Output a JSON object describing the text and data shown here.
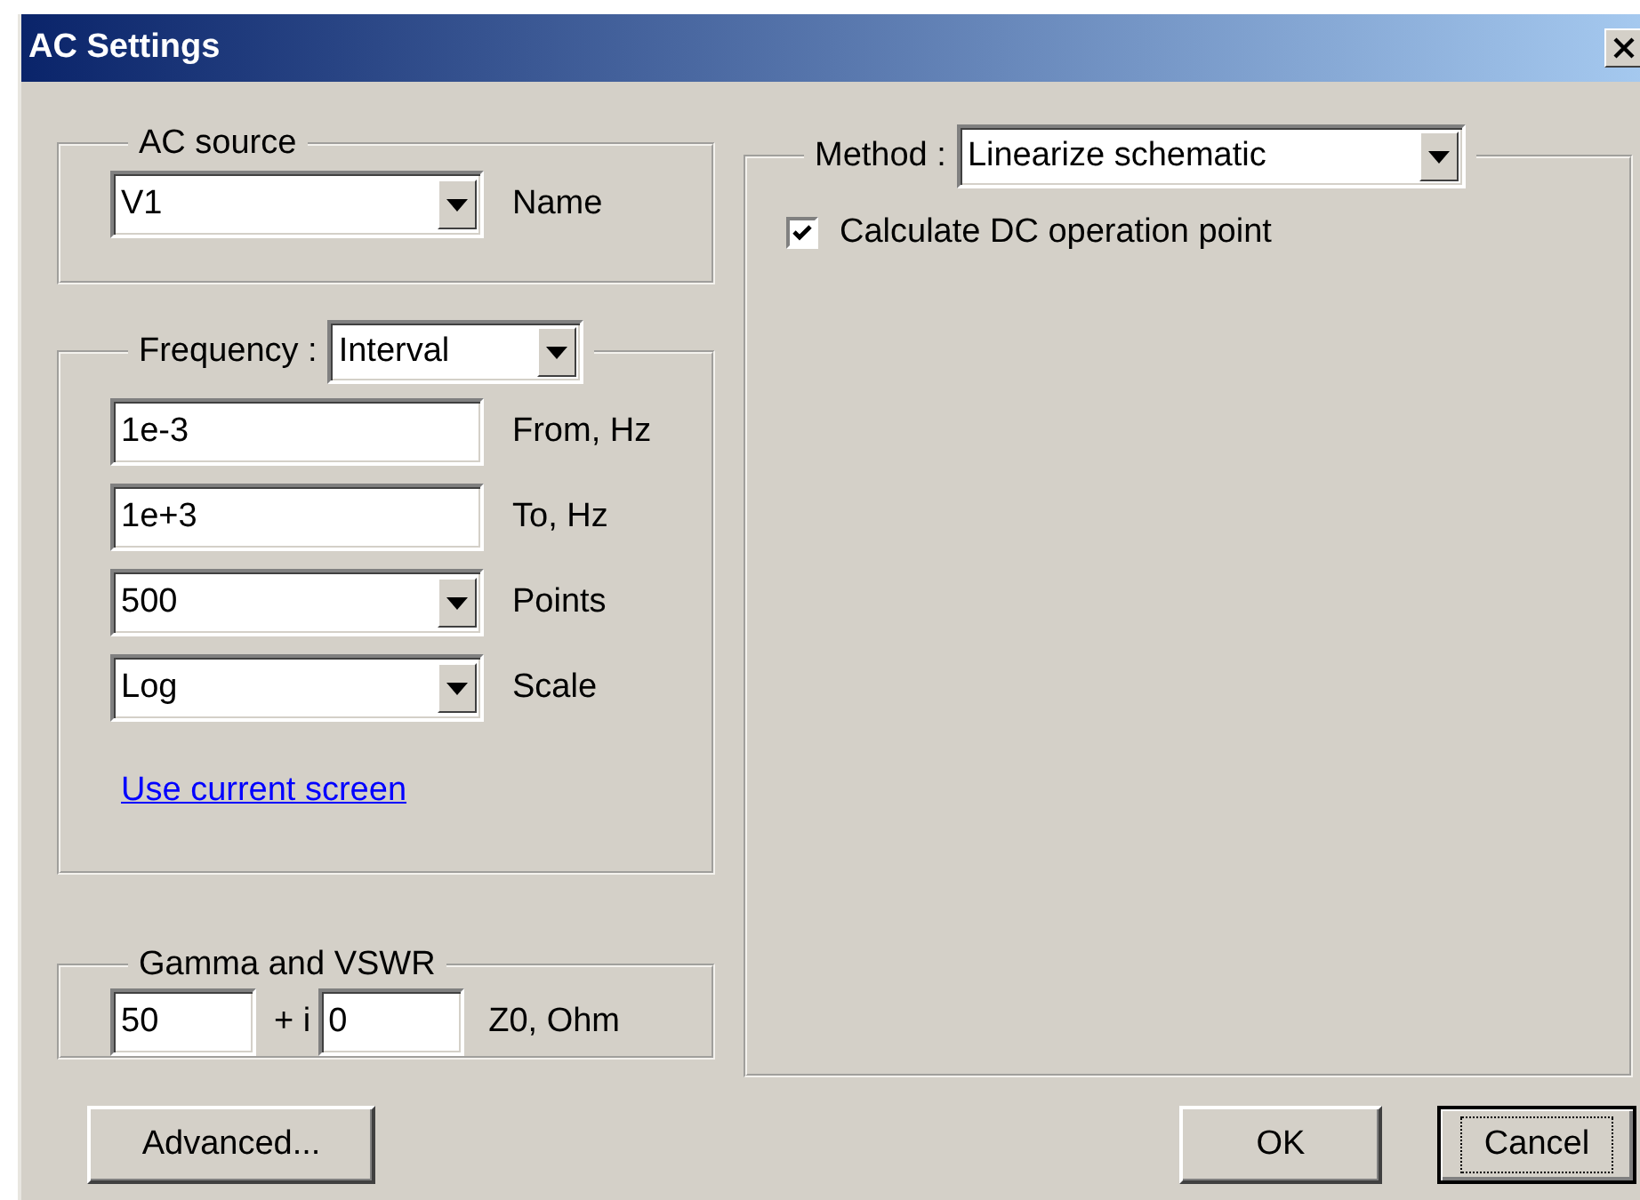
{
  "window": {
    "title": "AC Settings"
  },
  "ac_source": {
    "label": "AC source",
    "value": "V1",
    "field_label": "Name"
  },
  "frequency": {
    "label": "Frequency :",
    "mode": "Interval",
    "fields": [
      {
        "kind": "text",
        "value": "1e-3",
        "label": "From, Hz"
      },
      {
        "kind": "text",
        "value": "1e+3",
        "label": "To, Hz"
      },
      {
        "kind": "combo",
        "value": "500",
        "label": "Points"
      },
      {
        "kind": "combo",
        "value": "Log",
        "label": "Scale"
      }
    ],
    "link": "Use current screen"
  },
  "gamma": {
    "label": "Gamma and VSWR",
    "real": "50",
    "separator": "+ i",
    "imag": "0",
    "unit": "Z0, Ohm"
  },
  "method": {
    "label": "Method :",
    "value": "Linearize schematic",
    "options": [
      {
        "label": "Calculate DC operation point",
        "checked": true
      }
    ]
  },
  "buttons": [
    {
      "label": "Advanced...",
      "focused": false
    },
    {
      "label": "OK",
      "focused": false
    },
    {
      "label": "Cancel",
      "focused": true
    }
  ]
}
